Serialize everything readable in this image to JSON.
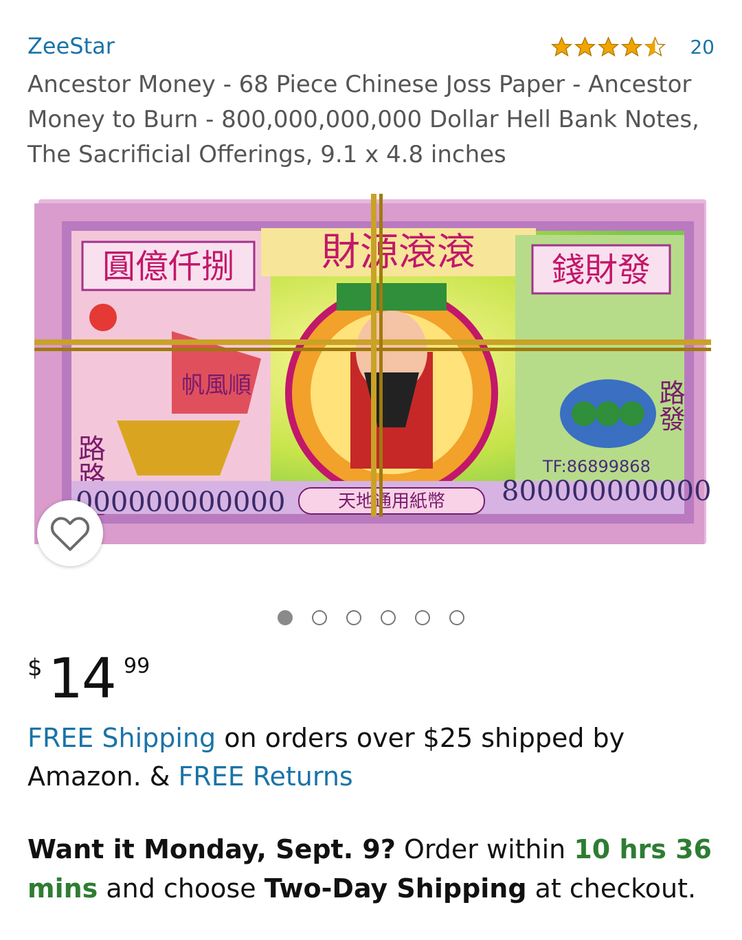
{
  "product": {
    "brand": "ZeeStar",
    "rating_count": "20",
    "rating_value": 4.5,
    "title": "Ancestor Money - 68 Piece Chinese Joss Paper - Ancestor Money to Burn - 800,000,000,000 Dollar Hell Bank Notes, The Sacrificial Offerings, 9.1 x 4.8 inches"
  },
  "banknote": {
    "top_banner": "財源滾滾",
    "left_label": "圓億仟捌",
    "right_label": "錢財發",
    "ship_text": "帆風順",
    "left_side": "路路通",
    "right_side": "路發",
    "serial_left": "000000000000",
    "serial_right": "800000000000",
    "center_bottom": "天地通用紙幣",
    "phone": "TF:86899868"
  },
  "carousel": {
    "total": 6,
    "active_index": 0
  },
  "price": {
    "currency": "$",
    "whole": "14",
    "fraction": "99"
  },
  "shipping": {
    "free_shipping_link": "FREE Shipping",
    "text_1": " on orders over $25 shipped by Amazon. & ",
    "free_returns_link": "FREE Returns"
  },
  "delivery": {
    "prefix_bold": "Want it Monday, Sept. 9?",
    "text_1": " Order within ",
    "countdown": "10 hrs 36 mins",
    "text_2": " and choose ",
    "option_bold": "Two-Day Shipping",
    "text_3": " at checkout."
  },
  "colors": {
    "link": "#1a73a8",
    "star": "#f0a500",
    "countdown": "#2e7d32"
  },
  "icons": {
    "wishlist": "heart-outline-icon",
    "rating": "star-icon"
  }
}
